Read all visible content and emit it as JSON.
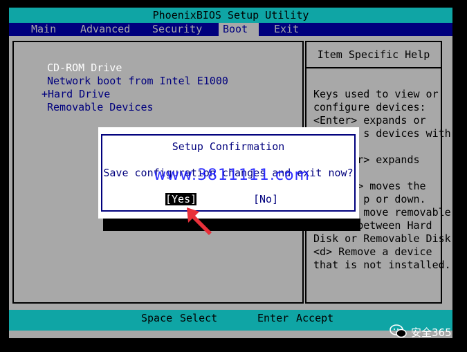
{
  "title": "PhoenixBIOS Setup Utility",
  "menu": [
    {
      "label": "Main",
      "active": false
    },
    {
      "label": "Advanced",
      "active": false
    },
    {
      "label": "Security",
      "active": false
    },
    {
      "label": "Boot",
      "active": true
    },
    {
      "label": "Exit",
      "active": false
    }
  ],
  "boot_items": [
    "CD-ROM Drive",
    "Network boot from Intel E1000",
    "+Hard Drive",
    "Removable Devices"
  ],
  "help": {
    "title": "Item Specific Help",
    "lines": [
      "Keys used to view or",
      "configure devices:",
      "<Enter> expands or",
      "        s devices with",
      "",
      "     der> expands",
      "",
      "     <-> moves the",
      "        p or down.",
      "        move removable",
      "device between Hard",
      "Disk or Removable Disk",
      "<d> Remove a device",
      "that is not installed."
    ]
  },
  "dialog": {
    "title": "Setup Confirmation",
    "message": "Save configuration changes and exit now?",
    "yes": "[Yes]",
    "no": "[No]"
  },
  "watermark": "www.3811111.com",
  "status": {
    "key1": "Space",
    "label1": "Select",
    "key2": "Enter",
    "label2": "Accept"
  },
  "brand": "安全365",
  "colors": {
    "accent": "#0fa5a5",
    "navy": "#00007d",
    "panel": "#a8a8a8",
    "arrow": "#e8303a"
  }
}
